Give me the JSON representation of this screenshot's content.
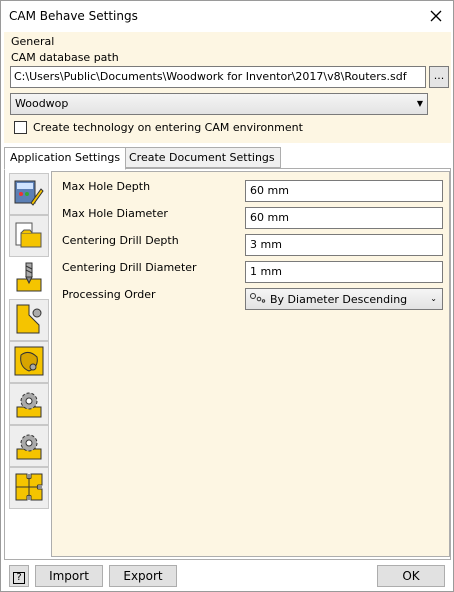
{
  "window": {
    "title": "CAM Behave Settings"
  },
  "general": {
    "label": "General",
    "db_path_label": "CAM database path",
    "db_path_value": "C:\\Users\\Public\\Documents\\Woodwork for Inventor\\2017\\v8\\Routers.sdf",
    "browse_label": "...",
    "machine_value": "Woodwop",
    "create_tech_label": "Create technology on entering CAM environment",
    "create_tech_checked": false
  },
  "tabs": [
    {
      "label": "Application Settings",
      "active": true
    },
    {
      "label": "Create Document Settings",
      "active": false
    }
  ],
  "sidebar": [
    "machine-settings-icon",
    "folder-document-icon",
    "drill-icon",
    "corner-tool-icon",
    "shape-tool-icon",
    "gear-machine-icon",
    "gear-machine-2-icon",
    "puzzle-icon"
  ],
  "settings": [
    {
      "label": "Max Hole Depth",
      "value": "60 mm"
    },
    {
      "label": "Max Hole Diameter",
      "value": "60 mm"
    },
    {
      "label": "Centering Drill Depth",
      "value": "3 mm"
    },
    {
      "label": "Centering Drill Diameter",
      "value": "1 mm"
    },
    {
      "label": "Processing Order",
      "value": "By Diameter Descending"
    }
  ],
  "buttons": {
    "help": "?",
    "import": "Import",
    "export": "Export",
    "ok": "OK"
  },
  "colors": {
    "panel_bg": "#fdf6e3",
    "icon_yellow": "#f5c400"
  }
}
